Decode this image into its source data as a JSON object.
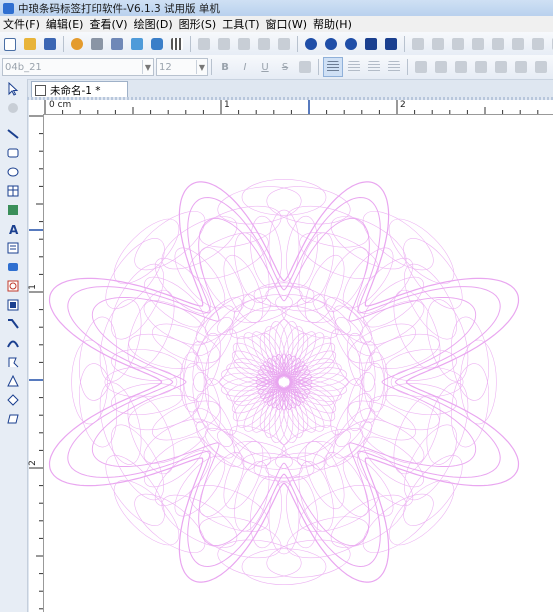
{
  "window": {
    "title": "中琅条码标签打印软件-V6.1.3 试用版 单机"
  },
  "menu": [
    {
      "label": "文件(F)"
    },
    {
      "label": "编辑(E)"
    },
    {
      "label": "查看(V)"
    },
    {
      "label": "绘图(D)"
    },
    {
      "label": "图形(S)"
    },
    {
      "label": "工具(T)"
    },
    {
      "label": "窗口(W)"
    },
    {
      "label": "帮助(H)"
    }
  ],
  "toolbar": {
    "font_name": "04b_21",
    "font_size": "12",
    "colors": {
      "accent": "#2f6fd0",
      "ruler_marker": "#1f4ea8",
      "pattern": "#e9a6f0"
    }
  },
  "document": {
    "tab_label": "未命名-1 *"
  },
  "rulers": {
    "unit": "cm",
    "horizontal_labels": [
      "0 cm",
      "1",
      "2"
    ],
    "vertical_labels": [
      "1",
      "2"
    ]
  },
  "left_tools": [
    "pointer-icon",
    "pan-icon",
    "line-icon",
    "rounded-rect-icon",
    "ellipse-icon",
    "table-icon",
    "image-icon",
    "text-icon",
    "richtext-icon",
    "barcode-icon",
    "qrcode-icon",
    "datamatrix-icon",
    "polyline-icon",
    "arc-icon",
    "bezier-icon",
    "triangle-icon",
    "diamond-icon",
    "parallelogram-icon"
  ]
}
